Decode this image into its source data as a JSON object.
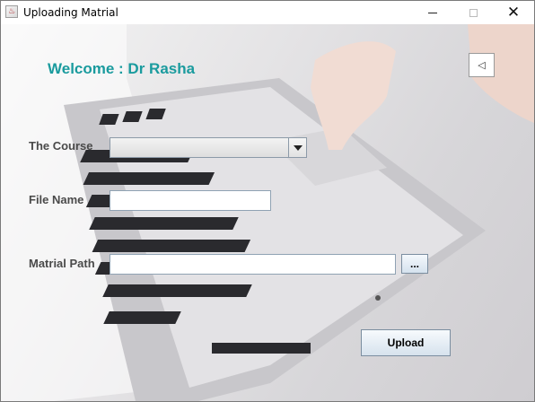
{
  "window": {
    "title": "Uploading Matrial",
    "controls": {
      "minimize": "",
      "maximize": "",
      "close": "✕"
    }
  },
  "header": {
    "welcome": "Welcome : Dr Rasha",
    "back_icon": "◁"
  },
  "form": {
    "course_label": "The Course",
    "course_selected": "",
    "file_name_label": "File Name",
    "file_name_value": "",
    "path_label": "Matrial Path",
    "path_value": "",
    "browse_label": "...",
    "upload_label": "Upload"
  },
  "colors": {
    "welcome": "#1a9b9e",
    "label": "#4a4a4a"
  },
  "icons": {
    "app": "java-icon",
    "back": "back-triangle-icon"
  }
}
